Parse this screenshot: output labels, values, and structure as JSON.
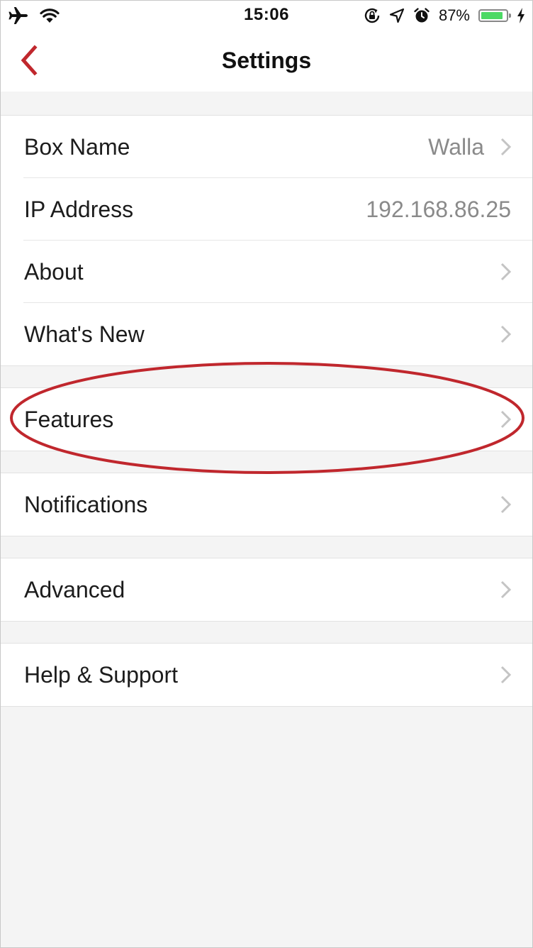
{
  "status_bar": {
    "time": "15:06",
    "battery_percent": "87%",
    "battery_level": 0.87,
    "icons": [
      "airplane-icon",
      "wifi-icon",
      "rotation-lock-icon",
      "location-icon",
      "alarm-icon",
      "battery-icon",
      "charging-icon"
    ]
  },
  "nav": {
    "title": "Settings",
    "back_icon": "chevron-left-icon",
    "accent_color": "#c0272d"
  },
  "groups": [
    {
      "rows": [
        {
          "label": "Box Name",
          "value": "Walla",
          "chevron": true
        },
        {
          "label": "IP Address",
          "value": "192.168.86.25",
          "chevron": false
        },
        {
          "label": "About",
          "value": "",
          "chevron": true
        },
        {
          "label": "What's New",
          "value": "",
          "chevron": true
        }
      ]
    },
    {
      "rows": [
        {
          "label": "Features",
          "value": "",
          "chevron": true
        }
      ]
    },
    {
      "rows": [
        {
          "label": "Notifications",
          "value": "",
          "chevron": true
        }
      ]
    },
    {
      "rows": [
        {
          "label": "Advanced",
          "value": "",
          "chevron": true
        }
      ]
    },
    {
      "rows": [
        {
          "label": "Help & Support",
          "value": "",
          "chevron": true
        }
      ]
    }
  ],
  "annotation": {
    "highlight_color": "#c0272d",
    "highlighted_row": "Features"
  }
}
